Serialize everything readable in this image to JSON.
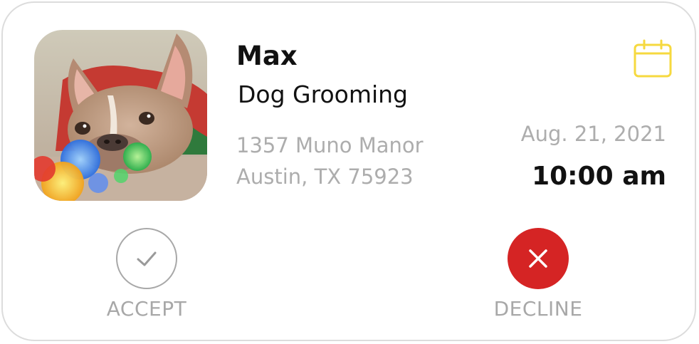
{
  "appointment": {
    "pet_name": "Max",
    "service": "Dog Grooming",
    "address_line1": "1357 Muno Manor",
    "address_line2": "Austin, TX 75923",
    "date": "Aug. 21, 2021",
    "time": "10:00 am"
  },
  "actions": {
    "accept_label": "ACCEPT",
    "decline_label": "DECLINE"
  },
  "icons": {
    "calendar": "calendar-icon",
    "accept": "checkmark-icon",
    "decline": "close-icon"
  },
  "colors": {
    "calendar_icon": "#f6d93f",
    "decline_button": "#d52424",
    "muted_text": "#adadad",
    "primary_text": "#111111",
    "card_border": "#dcdcdc"
  }
}
